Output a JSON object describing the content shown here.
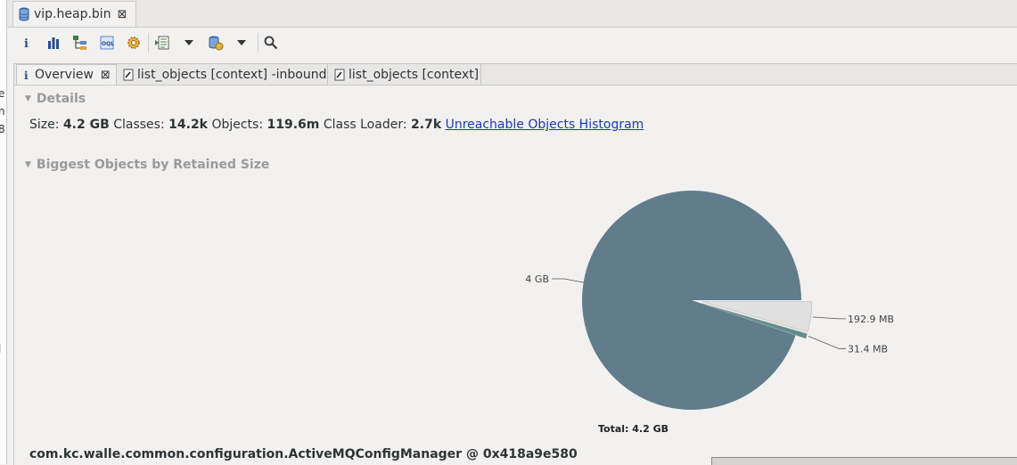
{
  "colors": {
    "pie_main": "#617d8c",
    "pie_slice_light": "#e0e0e0",
    "pie_slice_teal": "#5e8e8a",
    "link": "#1a3ab8",
    "section_header": "#9a9a9a"
  },
  "editor_tab": {
    "icon": "database-icon",
    "title": "vip.heap.bin"
  },
  "toolbar": {
    "items": [
      "info-icon",
      "histogram-icon",
      "dominator-tree-icon",
      "oql-icon",
      "gear-icon",
      "run-report-icon",
      "dropdown-arrow-icon",
      "query-browser-icon",
      "dropdown-arrow-icon",
      "search-icon"
    ]
  },
  "subtabs": [
    {
      "label": "Overview",
      "icon": "info-icon",
      "closable": true,
      "active": true
    },
    {
      "label": "list_objects [context] -inbound",
      "icon": "list-objects-icon",
      "closable": false,
      "active": false
    },
    {
      "label": "list_objects [context]",
      "icon": "list-objects-icon",
      "closable": false,
      "active": false
    }
  ],
  "details": {
    "header": "Details",
    "size_label": "Size:",
    "size_value": "4.2 GB",
    "classes_label": "Classes:",
    "classes_value": "14.2k",
    "objects_label": "Objects:",
    "objects_value": "119.6m",
    "loader_label": "Class Loader:",
    "loader_value": "2.7k",
    "histogram_link": "Unreachable Objects Histogram"
  },
  "biggest_objects": {
    "header": "Biggest Objects by Retained Size",
    "selected_object": "com.kc.walle.common.configuration.ActiveMQConfigManager @ 0x418a9e580"
  },
  "chart_data": {
    "type": "pie",
    "unit": "MB",
    "slices": [
      {
        "label": "4 GB",
        "value": 4096,
        "color": "#617d8c"
      },
      {
        "label": "192.9 MB",
        "value": 192.9,
        "color": "#e0e0e0",
        "exploded": true
      },
      {
        "label": "31.4 MB",
        "value": 31.4,
        "color": "#5e8e8a",
        "exploded": true
      }
    ],
    "total_label": "Total: 4.2 GB"
  },
  "left_strip_chars": [
    "e",
    "n",
    "8",
    "l"
  ]
}
